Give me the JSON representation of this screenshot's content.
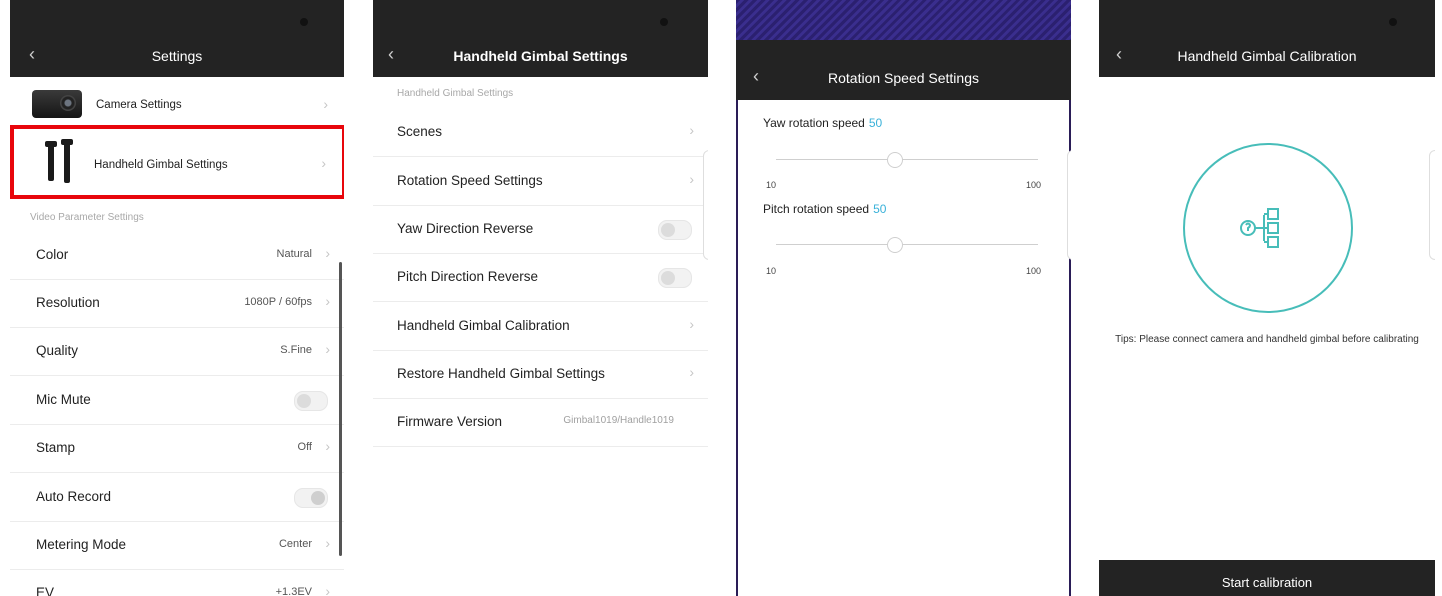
{
  "settings_screen": {
    "title": "Settings",
    "camera_settings": "Camera Settings",
    "handheld_gimbal_settings": "Handheld Gimbal Settings",
    "section": "Video  Parameter Settings",
    "rows": [
      {
        "label": "Color",
        "value": "Natural"
      },
      {
        "label": "Resolution",
        "value": "1080P / 60fps"
      },
      {
        "label": "Quality",
        "value": "S.Fine"
      },
      {
        "label": "Mic Mute"
      },
      {
        "label": "Stamp",
        "value": "Off"
      },
      {
        "label": "Auto Record"
      },
      {
        "label": "Metering Mode",
        "value": "Center"
      },
      {
        "label": "EV",
        "value": "+1.3EV"
      }
    ]
  },
  "gimbal_screen": {
    "title": "Handheld Gimbal Settings",
    "section": "Handheld Gimbal Settings",
    "rows": [
      {
        "label": "Scenes"
      },
      {
        "label": "Rotation Speed Settings"
      },
      {
        "label": "Yaw Direction Reverse"
      },
      {
        "label": "Pitch Direction Reverse"
      },
      {
        "label": "Handheld Gimbal Calibration"
      },
      {
        "label": "Restore Handheld Gimbal Settings"
      },
      {
        "label": "Firmware Version",
        "value": "Gimbal1019/Handle1019"
      }
    ]
  },
  "speed_screen": {
    "title": "Rotation Speed Settings",
    "yaw_label": "Yaw rotation speed",
    "yaw_value": "50",
    "pitch_label": "Pitch rotation speed",
    "pitch_value": "50",
    "min": "10",
    "max": "100"
  },
  "calibration_screen": {
    "title": "Handheld Gimbal Calibration",
    "tips": "Tips: Please connect camera and handheld gimbal before calibrating",
    "start_button": "Start calibration"
  },
  "colors": {
    "header": "#232323",
    "accent": "#39b1d9",
    "highlight": "#e8060c",
    "circle": "#47bdb9"
  }
}
